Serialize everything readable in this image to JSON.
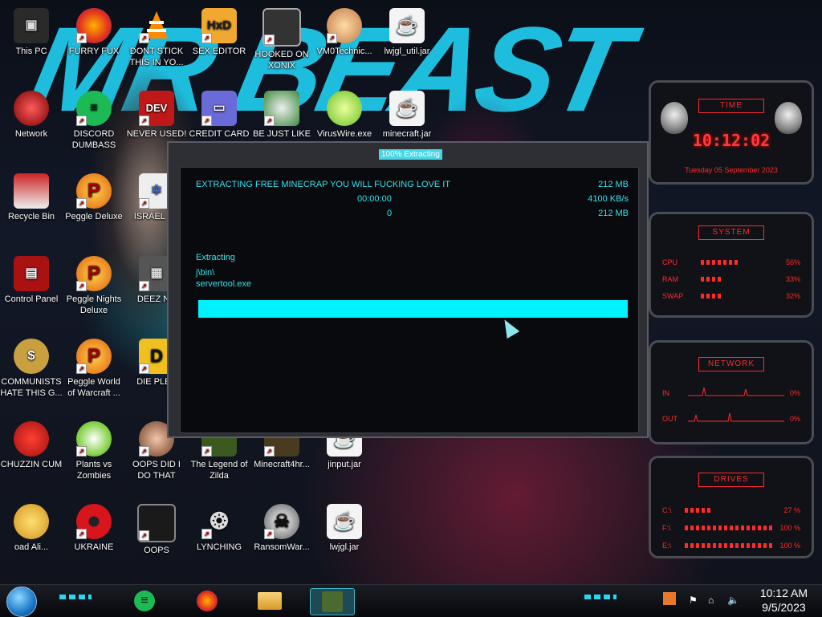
{
  "desktop": {
    "background_text": "MR BEAST",
    "icons": [
      {
        "label": "This PC"
      },
      {
        "label": "FURRY FUX"
      },
      {
        "label": "DONT STICK THIS IN YO..."
      },
      {
        "label": "SEX EDITOR"
      },
      {
        "label": "HOOKED ON XONIX"
      },
      {
        "label": "VM0Technic..."
      },
      {
        "label": "lwjgl_util.jar"
      },
      {
        "label": "Network"
      },
      {
        "label": "DISCORD DUMBASS"
      },
      {
        "label": "NEVER USED!"
      },
      {
        "label": "CREDIT CARD"
      },
      {
        "label": "BE JUST LIKE"
      },
      {
        "label": "VirusWire.exe"
      },
      {
        "label": "minecraft.jar"
      },
      {
        "label": "Recycle Bin"
      },
      {
        "label": "Peggle Deluxe"
      },
      {
        "label": "ISRAEL SP"
      },
      {
        "label": "Control Panel"
      },
      {
        "label": "Peggle Nights Deluxe"
      },
      {
        "label": "DEEZ NU"
      },
      {
        "label": "COMMUNISTS HATE THIS G..."
      },
      {
        "label": "Peggle World of Warcraft ..."
      },
      {
        "label": "DIE PLEA"
      },
      {
        "label": "CHUZZIN CUM"
      },
      {
        "label": "Plants vs Zombies"
      },
      {
        "label": "OOPS DID I DO THAT"
      },
      {
        "label": "The Legend of Zilda"
      },
      {
        "label": "Minecraft4hr..."
      },
      {
        "label": "jinput.jar"
      },
      {
        "label": "oad Ali..."
      },
      {
        "label": "UKRAINE"
      },
      {
        "label": "OOPS"
      },
      {
        "label": "LYNCHING"
      },
      {
        "label": "RansomWar..."
      },
      {
        "label": "lwjgl.jar"
      }
    ]
  },
  "dialog": {
    "title": "100% Extracting",
    "heading": "EXTRACTING FREE MINECRAP YOU WILL FUCKING LOVE IT",
    "total_size": "212 MB",
    "elapsed": "00:00:00",
    "speed": "4100 KB/s",
    "processed": "0",
    "processed_size": "212 MB",
    "status": "Extracting",
    "path": "j\\bin\\",
    "file": "servertool.exe",
    "progress": 1.0
  },
  "gadgets": {
    "time": {
      "header": "TIME",
      "time": "10:12:02",
      "date": "Tuesday 05 September 2023"
    },
    "system": {
      "header": "SYSTEM",
      "rows": [
        {
          "label": "CPU",
          "value": "56%"
        },
        {
          "label": "RAM",
          "value": "33%"
        },
        {
          "label": "SWAP",
          "value": "32%"
        }
      ]
    },
    "network": {
      "header": "NETWORK",
      "rows": [
        {
          "label": "IN",
          "value": "0%"
        },
        {
          "label": "OUT",
          "value": "0%"
        }
      ]
    },
    "drives": {
      "header": "DRIVES",
      "rows": [
        {
          "label": "C:\\",
          "value": "27 %"
        },
        {
          "label": "F:\\",
          "value": "100 %"
        },
        {
          "label": "E:\\",
          "value": "100 %"
        }
      ]
    }
  },
  "taskbar": {
    "clock_time": "10:12 AM",
    "clock_date": "9/5/2023"
  },
  "colors": {
    "accent": "#00f2ff",
    "gadget_red": "#ff2a2a",
    "dialog_text": "#34e3f0"
  }
}
